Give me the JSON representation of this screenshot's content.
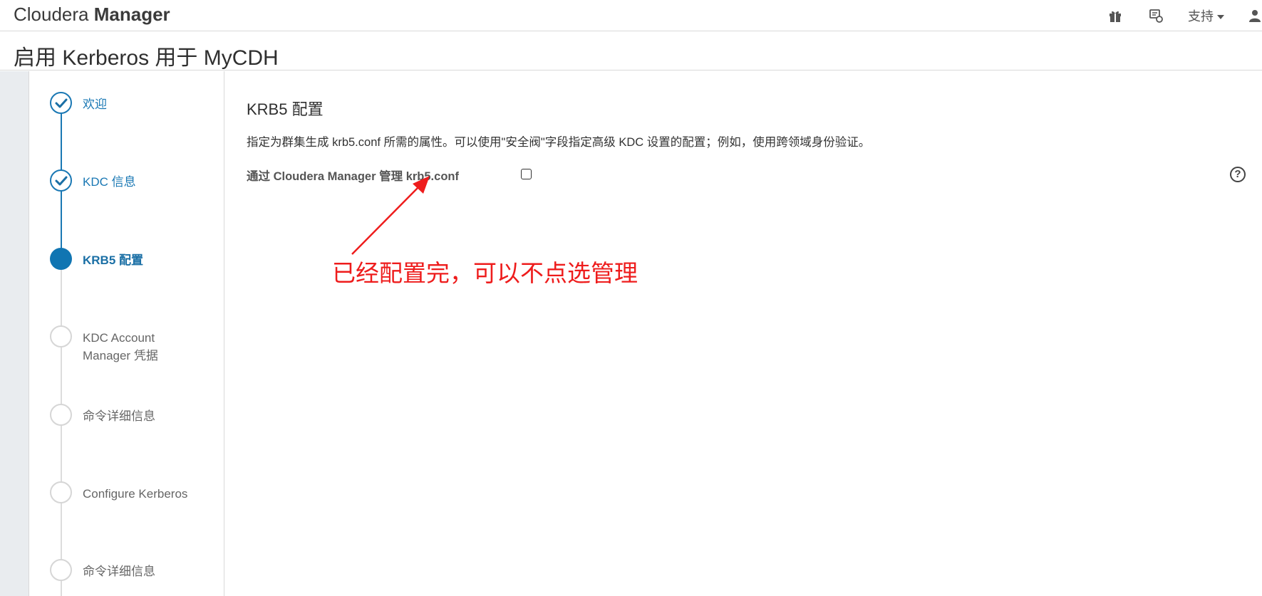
{
  "header": {
    "brand_light": "Cloudera",
    "brand_bold": "Manager",
    "icons": [
      "gift-icon",
      "notification-icon"
    ],
    "support_label": "支持",
    "user_icon": "user-icon"
  },
  "page": {
    "title": "启用 Kerberos 用于 MyCDH"
  },
  "steps": [
    {
      "label": "欢迎",
      "state": "done"
    },
    {
      "label": "KDC 信息",
      "state": "done"
    },
    {
      "label": "KRB5 配置",
      "state": "active"
    },
    {
      "label": "KDC Account Manager 凭据",
      "state": "todo"
    },
    {
      "label": "命令详细信息",
      "state": "todo"
    },
    {
      "label": "Configure Kerberos",
      "state": "todo"
    },
    {
      "label": "命令详细信息",
      "state": "todo"
    }
  ],
  "main": {
    "section_title": "KRB5 配置",
    "description": "指定为群集生成 krb5.conf 所需的属性。可以使用\"安全阀\"字段指定高级 KDC 设置的配置；例如，使用跨领域身份验证。",
    "field_label": "通过 Cloudera Manager 管理 krb5.conf",
    "field_checked": false,
    "help_symbol": "?"
  },
  "annotation": {
    "text": "已经配置完，可以不点选管理",
    "color": "#ee1c1c"
  },
  "colors": {
    "accent": "#1075b2",
    "step_done": "#1a78b4",
    "step_todo_border": "#d6d6d6"
  }
}
